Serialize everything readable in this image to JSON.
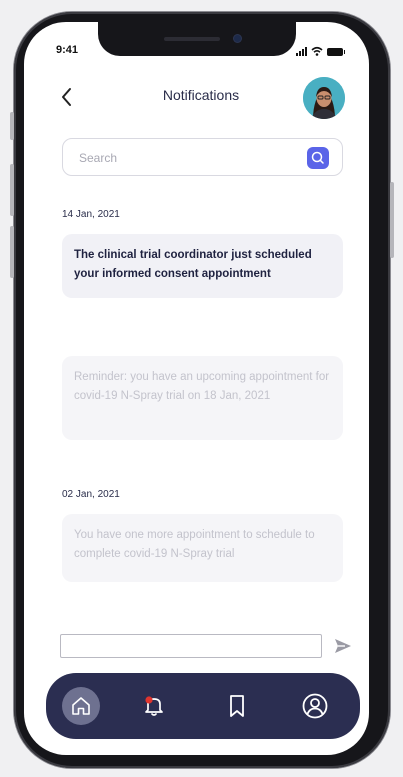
{
  "status_bar": {
    "time": "9:41"
  },
  "header": {
    "title": "Notifications"
  },
  "search": {
    "placeholder": "Search"
  },
  "groups": [
    {
      "date": "14 Jan, 2021",
      "notifications": [
        {
          "text": "The clinical trial coordinator just scheduled your informed consent appointment",
          "state": "unread"
        },
        {
          "text": "Reminder: you have an upcoming appointment for covid-19 N-Spray trial on 18 Jan, 2021",
          "state": "read"
        }
      ]
    },
    {
      "date": "02 Jan, 2021",
      "notifications": [
        {
          "text": "You have one more appointment  to schedule to complete covid-19 N-Spray trial",
          "state": "read"
        }
      ]
    }
  ],
  "message_bar": {
    "value": ""
  },
  "bottom_nav": {
    "items": [
      "home-icon",
      "bell-icon",
      "bookmark-icon",
      "user-icon"
    ],
    "active": "home-icon",
    "badge_color": "#e0342e"
  },
  "colors": {
    "accent": "#5a64e8",
    "nav_background": "#2b2e51",
    "title_text": "#2a2d4a"
  }
}
